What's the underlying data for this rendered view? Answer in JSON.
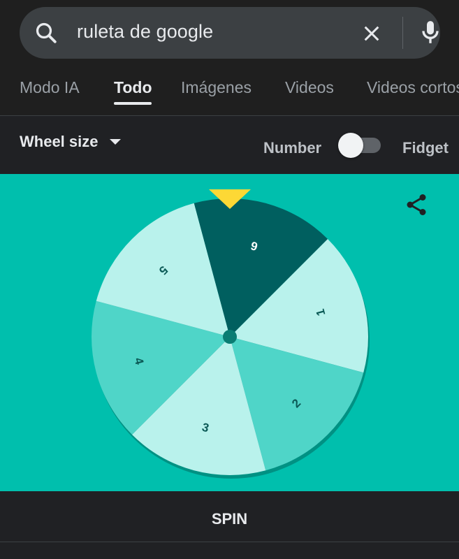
{
  "search": {
    "query": "ruleta de google",
    "search_icon": "search-icon",
    "clear_icon": "close-icon",
    "mic_icon": "mic-icon"
  },
  "tabs": [
    {
      "label": "Modo IA",
      "active": false
    },
    {
      "label": "Todo",
      "active": true
    },
    {
      "label": "Imágenes",
      "active": false
    },
    {
      "label": "Videos",
      "active": false
    },
    {
      "label": "Videos cortos",
      "active": false
    }
  ],
  "controls": {
    "wheel_size_label": "Wheel size",
    "number_label": "Number",
    "fidget_label": "Fidget",
    "toggle_on": false
  },
  "wheel": {
    "segments": [
      {
        "label": "1",
        "color": "#b9f2ec"
      },
      {
        "label": "2",
        "color": "#4fd5c8"
      },
      {
        "label": "3",
        "color": "#b9f2ec"
      },
      {
        "label": "4",
        "color": "#4fd5c8"
      },
      {
        "label": "5",
        "color": "#b9f2ec"
      },
      {
        "label": "6",
        "color": "#005f5f"
      }
    ],
    "background": "#00bfad",
    "pointer_color": "#fdd835",
    "share_icon": "share-icon"
  },
  "spin": {
    "label": "SPIN"
  }
}
